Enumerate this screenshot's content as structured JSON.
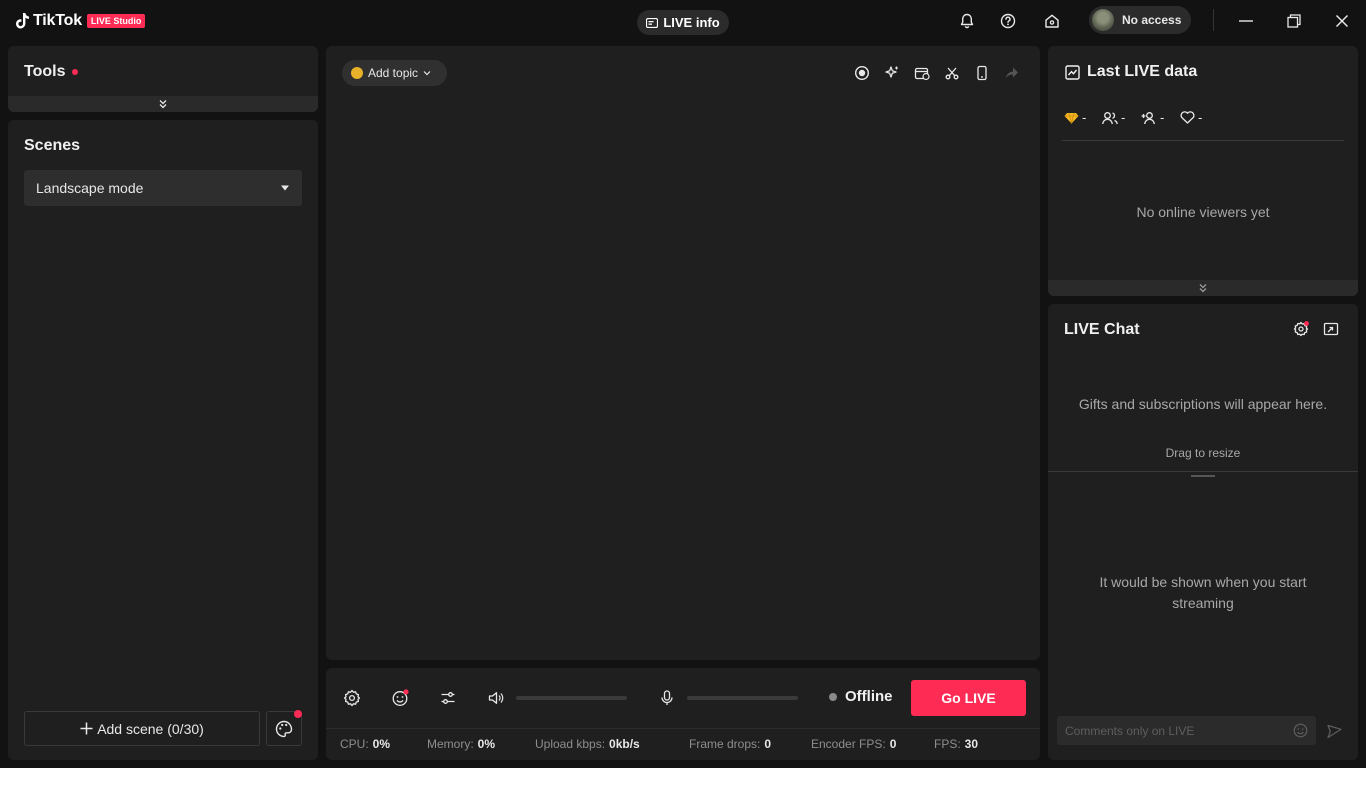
{
  "titlebar": {
    "app_name": "TikTok",
    "badge": "LIVE Studio",
    "live_info": "LIVE info",
    "account": "No access"
  },
  "tools": {
    "title": "Tools"
  },
  "scenes": {
    "title": "Scenes",
    "mode_selected": "Landscape mode",
    "add_scene": "Add scene (0/30)"
  },
  "preview": {
    "add_topic": "Add topic"
  },
  "controls": {
    "status": "Offline",
    "go_live": "Go LIVE"
  },
  "stats": [
    {
      "label": "CPU:",
      "value": "0%"
    },
    {
      "label": "Memory:",
      "value": "0%"
    },
    {
      "label": "Upload kbps:",
      "value": "0kb/s"
    },
    {
      "label": "Frame drops:",
      "value": "0"
    },
    {
      "label": "Encoder FPS:",
      "value": "0"
    },
    {
      "label": "FPS:",
      "value": "30"
    }
  ],
  "last_live": {
    "title": "Last LIVE data",
    "metrics": [
      {
        "icon": "diamond-icon",
        "value": "-"
      },
      {
        "icon": "viewers-icon",
        "value": "-"
      },
      {
        "icon": "new-followers-icon",
        "value": "-"
      },
      {
        "icon": "likes-icon",
        "value": "-"
      }
    ],
    "empty": "No online viewers yet"
  },
  "chat": {
    "title": "LIVE Chat",
    "gifts_hint": "Gifts and subscriptions will appear here.",
    "drag_hint": "Drag to resize",
    "empty": "It would be shown when you start streaming",
    "comment_placeholder": "Comments only on LIVE"
  },
  "colors": {
    "accent": "#fe2c55",
    "background": "#121212",
    "panel": "#1f1f1f"
  }
}
